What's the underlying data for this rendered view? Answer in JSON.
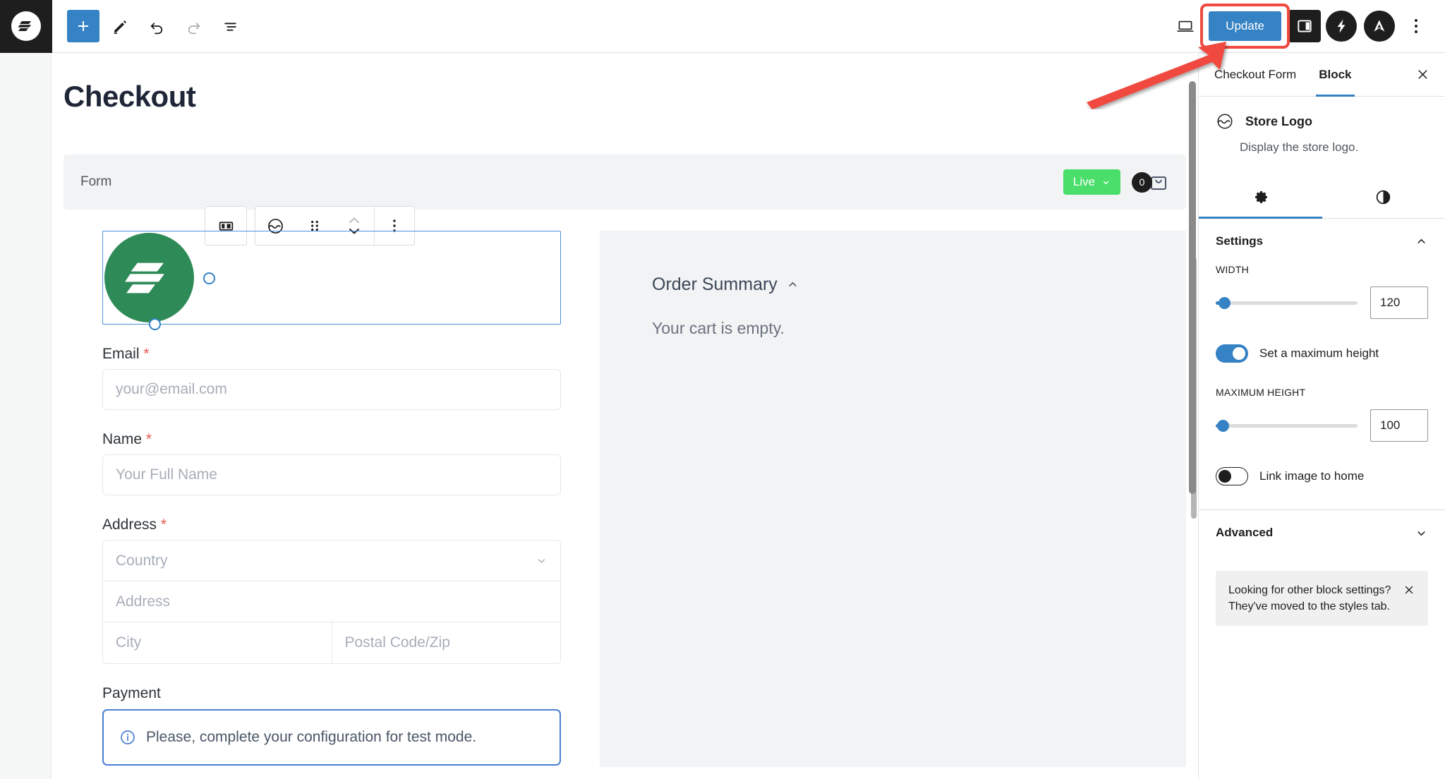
{
  "topbar": {
    "logo_icon": "surecart-logo-icon",
    "add_block_label": "+",
    "tools": [
      "add-block-button",
      "edit-tool-button",
      "undo-button",
      "redo-button",
      "list-view-button"
    ],
    "view_icon": "desktop-preview-icon",
    "update_label": "Update",
    "sidebar_toggle_icon": "settings-sidebar-icon",
    "plugin_icons": [
      "lightning-bolt-icon",
      "astra-logo-icon"
    ],
    "options_icon": "kebab-menu-icon"
  },
  "canvas": {
    "page_title": "Checkout",
    "form_bar": {
      "label": "Form",
      "live_label": "Live",
      "cart_count": "0",
      "cart_icon": "shopping-bag-icon"
    },
    "block_toolbar": {
      "layout_icon": "columns-layout-icon",
      "block_type_icon": "store-logo-icon",
      "drag_icon": "drag-handle-icon",
      "move_icon": "move-up-down-icon",
      "more_icon": "more-options-icon"
    },
    "logo_block": {
      "alt": "store-logo-image",
      "color": "#2e8b57"
    },
    "fields": [
      {
        "label": "Email",
        "required": true,
        "placeholder": "your@email.com"
      },
      {
        "label": "Name",
        "required": true,
        "placeholder": "Your Full Name"
      }
    ],
    "address": {
      "label": "Address",
      "required": true,
      "country_placeholder": "Country",
      "street_placeholder": "Address",
      "city_placeholder": "City",
      "postal_placeholder": "Postal Code/Zip"
    },
    "payment": {
      "label": "Payment",
      "notice": "Please, complete your configuration for test mode."
    },
    "summary": {
      "title": "Order Summary",
      "empty_text": "Your cart is empty."
    }
  },
  "sidebar": {
    "tabs": [
      {
        "label": "Checkout Form",
        "active": false
      },
      {
        "label": "Block",
        "active": true
      }
    ],
    "close_icon": "close-icon",
    "block": {
      "icon": "store-logo-icon",
      "title": "Store Logo",
      "description": "Display the store logo."
    },
    "icon_tabs": [
      {
        "icon": "gear-icon",
        "active": true
      },
      {
        "icon": "styles-contrast-icon",
        "active": false
      }
    ],
    "settings": {
      "title": "Settings",
      "chevron": "chevron-up-icon",
      "width": {
        "label": "WIDTH",
        "value": "120",
        "percent": 5
      },
      "max_height_toggle": {
        "label": "Set a maximum height",
        "on": true
      },
      "max_height": {
        "label": "MAXIMUM HEIGHT",
        "value": "100",
        "percent": 3
      },
      "link_toggle": {
        "label": "Link image to home",
        "on": false
      }
    },
    "advanced": {
      "title": "Advanced",
      "chevron": "chevron-down-icon"
    },
    "notice": {
      "text": "Looking for other block settings? They've moved to the styles tab.",
      "close_icon": "close-icon"
    }
  },
  "annotation": {
    "arrow_color": "#f04a40",
    "highlight_color": "#f04a40"
  }
}
